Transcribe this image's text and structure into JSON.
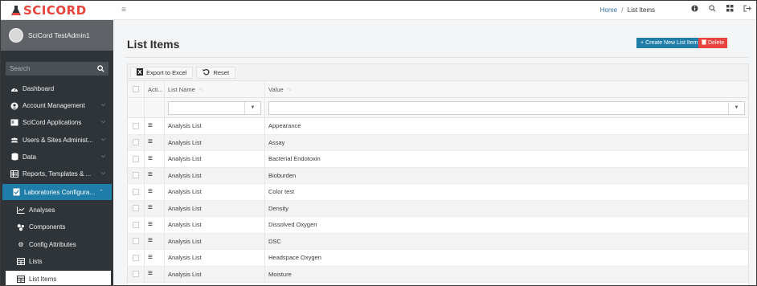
{
  "brand": {
    "name": "SCICORD",
    "color": "#e8433c"
  },
  "user": {
    "name": "SciCord TestAdmin1"
  },
  "sidebar": {
    "search_placeholder": "Search",
    "items": [
      {
        "label": "Dashboard",
        "icon": "dashboard-icon"
      },
      {
        "label": "Account Management",
        "icon": "account-icon",
        "chevron": "⌵"
      },
      {
        "label": "SciCord Applications",
        "icon": "applications-icon",
        "chevron": "⌵"
      },
      {
        "label": "Users & Sites Administ...",
        "icon": "users-icon",
        "chevron": "⌵"
      },
      {
        "label": "Data",
        "icon": "database-icon",
        "chevron": "⌵"
      },
      {
        "label": "Reports, Templates & ...",
        "icon": "reports-icon",
        "chevron": "⌵"
      },
      {
        "label": "Laboratories Configura...",
        "icon": "lab-icon",
        "chevron": "⌃"
      },
      {
        "label": "Analyses",
        "icon": "chart-icon"
      },
      {
        "label": "Components",
        "icon": "components-icon"
      },
      {
        "label": "Config Attributes",
        "icon": "gear-icon"
      },
      {
        "label": "Lists",
        "icon": "table-icon"
      },
      {
        "label": "List Items",
        "icon": "table-icon"
      }
    ]
  },
  "topbar": {
    "breadcrumb": {
      "home": "Home",
      "separator": "/",
      "current": "List Items"
    }
  },
  "main": {
    "title": "List Items",
    "create_button": "Create New List Item",
    "delete_button": "Delete",
    "toolbar": {
      "export_label": "Export to Excel",
      "reset_label": "Reset"
    },
    "columns": {
      "actions": "Acti...",
      "list_name": "List Name",
      "value": "Value",
      "list_name_sort": "↑₁",
      "value_sort": "↑₂"
    },
    "rows": [
      {
        "list_name": "Analysis List",
        "value": "Appearance"
      },
      {
        "list_name": "Analysis List",
        "value": "Assay"
      },
      {
        "list_name": "Analysis List",
        "value": "Bacterial Endotoxin"
      },
      {
        "list_name": "Analysis List",
        "value": "Bioburden"
      },
      {
        "list_name": "Analysis List",
        "value": "Color test"
      },
      {
        "list_name": "Analysis List",
        "value": "Density"
      },
      {
        "list_name": "Analysis List",
        "value": "Dissolved Oxygen"
      },
      {
        "list_name": "Analysis List",
        "value": "DSC"
      },
      {
        "list_name": "Analysis List",
        "value": "Headspace Oxygen"
      },
      {
        "list_name": "Analysis List",
        "value": "Moisture"
      }
    ]
  },
  "colors": {
    "sidebar": "#2f3438",
    "accent": "#1f7ea9",
    "danger": "#e8433c"
  }
}
